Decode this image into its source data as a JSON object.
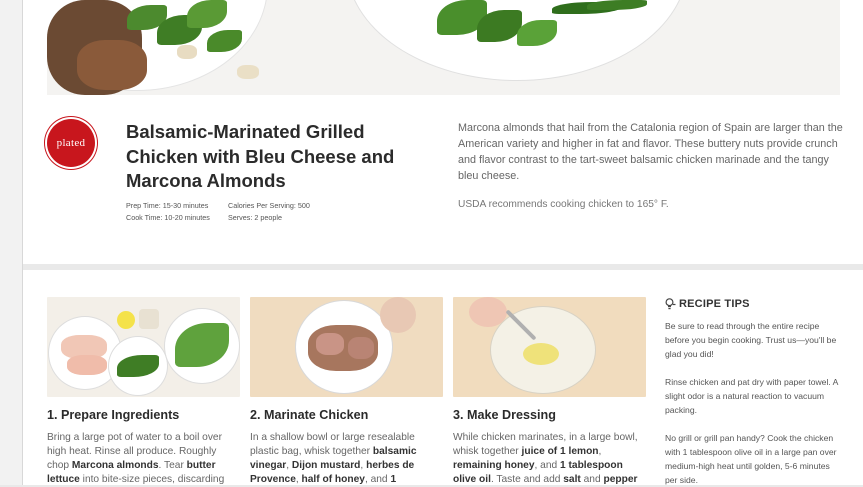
{
  "recipe": {
    "logo_text": "plated",
    "title": "Balsamic-Marinated Grilled Chicken with Bleu Cheese and Marcona Almonds",
    "prep_time": "Prep Time: 15-30 minutes",
    "cook_time": "Cook Time: 10-20 minutes",
    "calories": "Calories Per Serving: 500",
    "serves": "Serves: 2 people",
    "description": "Marcona almonds that hail from the Catalonia region of Spain are larger than the American variety and higher in fat and flavor. These buttery nuts provide crunch and flavor contrast to the tart-sweet balsamic chicken marinade and the tangy bleu cheese.",
    "usda_note": "USDA recommends cooking chicken to 165° F."
  },
  "steps": [
    {
      "title": "1. Prepare Ingredients",
      "text_parts": [
        {
          "t": "Bring a large pot of water to a boil over high heat. Rinse all produce. Roughly chop "
        },
        {
          "t": "Marcona almonds",
          "b": true
        },
        {
          "t": ". Tear "
        },
        {
          "t": "butter lettuce",
          "b": true
        },
        {
          "t": " into bite-size pieces, discarding"
        }
      ]
    },
    {
      "title": "2. Marinate Chicken",
      "text_parts": [
        {
          "t": "In a shallow bowl or large resealable plastic bag, whisk together "
        },
        {
          "t": "balsamic vinegar",
          "b": true
        },
        {
          "t": ", "
        },
        {
          "t": "Dijon mustard",
          "b": true
        },
        {
          "t": ", "
        },
        {
          "t": "herbes de Provence",
          "b": true
        },
        {
          "t": ", "
        },
        {
          "t": "half of honey",
          "b": true
        },
        {
          "t": ", and "
        },
        {
          "t": "1",
          "b": true
        }
      ]
    },
    {
      "title": "3. Make Dressing",
      "text_parts": [
        {
          "t": "While chicken marinates, in a large bowl, whisk together "
        },
        {
          "t": "juice of 1 lemon",
          "b": true
        },
        {
          "t": ", "
        },
        {
          "t": "remaining honey",
          "b": true
        },
        {
          "t": ", and "
        },
        {
          "t": "1 tablespoon olive oil",
          "b": true
        },
        {
          "t": ". Taste and add "
        },
        {
          "t": "salt",
          "b": true
        },
        {
          "t": " and "
        },
        {
          "t": "pepper",
          "b": true
        }
      ]
    }
  ],
  "tips": {
    "icon": "lightbulb-icon",
    "heading": "RECIPE TIPS",
    "items": [
      "Be sure to read through the entire recipe before you begin cooking. Trust us—you'll be glad you did!",
      "Rinse chicken and pat dry with paper towel. A slight odor is a natural reaction to vacuum packing.",
      "No grill or grill pan handy? Cook the chicken with 1 tablespoon olive oil in a large pan over medium-high heat until golden, 5-6 minutes per side."
    ]
  },
  "colors": {
    "brand_red": "#c8161d"
  }
}
